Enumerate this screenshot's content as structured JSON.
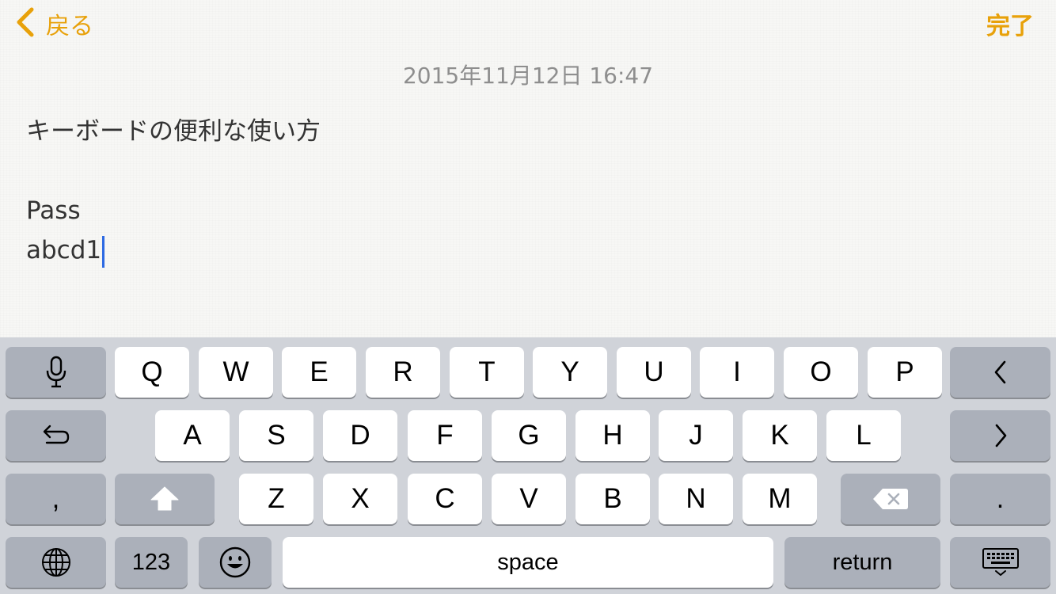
{
  "nav": {
    "back_label": "戻る",
    "done_label": "完了"
  },
  "note": {
    "timestamp": "2015年11月12日 16:47",
    "lines": [
      "キーボードの便利な使い方",
      "",
      "Pass",
      "abcd1"
    ]
  },
  "keyboard": {
    "row1": [
      "Q",
      "W",
      "E",
      "R",
      "T",
      "Y",
      "U",
      "I",
      "O",
      "P"
    ],
    "row2": [
      "A",
      "S",
      "D",
      "F",
      "G",
      "H",
      "J",
      "K",
      "L"
    ],
    "row3": [
      "Z",
      "X",
      "C",
      "V",
      "B",
      "N",
      "M"
    ],
    "comma": ",",
    "period": ".",
    "numbers_label": "123",
    "space_label": "space",
    "return_label": "return"
  },
  "colors": {
    "accent": "#e8a10a",
    "caret": "#2d6ae3",
    "keyboard_bg": "#d0d3d9",
    "key_light": "#ffffff",
    "key_dark": "#abb0ba"
  }
}
